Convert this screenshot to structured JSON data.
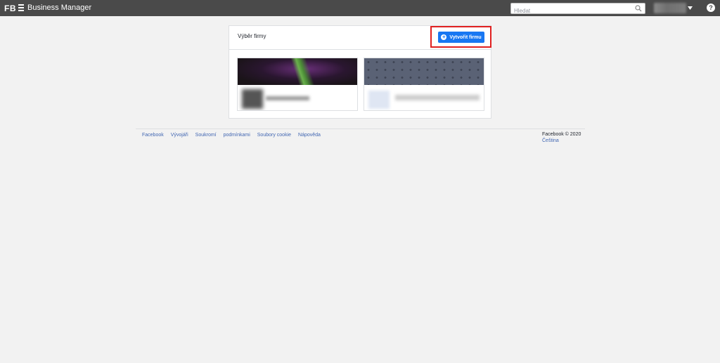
{
  "topbar": {
    "logo": "FB",
    "app_title": "Business Manager",
    "search_placeholder": "Hledat",
    "help": "?"
  },
  "panel": {
    "title": "Výběr firmy",
    "create_button_label": "Vytvořit firmu"
  },
  "footer": {
    "links": [
      "Facebook",
      "Vývojáři",
      "Soukromí",
      "podmínkami",
      "Soubory cookie",
      "Nápověda"
    ],
    "copyright": "Facebook © 2020",
    "language": "Čeština"
  },
  "colors": {
    "topbar": "#4a4a4a",
    "primary": "#1877f2",
    "highlight": "#e02020",
    "link": "#4267b2"
  }
}
